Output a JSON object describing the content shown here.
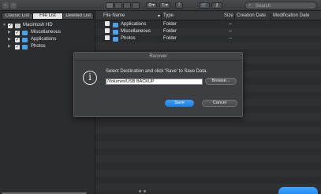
{
  "toolbar": {
    "back_icon": "chevron-left-icon",
    "forward_icon": "chevron-right-icon",
    "search_placeholder": "Search",
    "help_label": "?"
  },
  "left_panel": {
    "tabs": [
      {
        "label": "Classic List",
        "active": false
      },
      {
        "label": "File List",
        "active": true
      },
      {
        "label": "Deleted List",
        "active": false
      }
    ],
    "tree": [
      {
        "label": "Macintosh HD",
        "checked": true,
        "expanded": true
      },
      {
        "label": "Miscellaneous",
        "checked": true,
        "expanded": false
      },
      {
        "label": "Applications",
        "checked": true,
        "expanded": false
      },
      {
        "label": "Photos",
        "checked": true,
        "expanded": false
      }
    ]
  },
  "file_list": {
    "columns": {
      "name": "File Name",
      "type": "Type",
      "size": "Size",
      "creation": "Creation Date",
      "modification": "Modification Date"
    },
    "rows": [
      {
        "name": "Applications",
        "type": "Folder",
        "size": "--"
      },
      {
        "name": "Miscellaneous",
        "type": "Folder",
        "size": "--"
      },
      {
        "name": "Photos",
        "type": "Folder",
        "size": "--"
      }
    ]
  },
  "dialog": {
    "title": "Recover",
    "message": "Select Destination and click 'Save' to Save Data.",
    "destination": "/Volumes/USB BACKUP",
    "browse_label": "Browse...",
    "save_label": "Save",
    "cancel_label": "Cancel",
    "icon": "info-icon"
  },
  "colors": {
    "accent": "#1f86f0",
    "folder": "#4aa3e8",
    "background": "#2b2c2f"
  }
}
